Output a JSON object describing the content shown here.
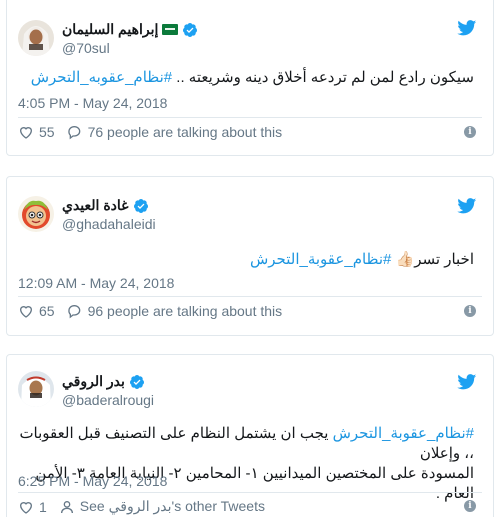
{
  "colors": {
    "link": "#1b95e0",
    "verified": "#1da1f2",
    "bird": "#1da1f2",
    "muted": "#657786"
  },
  "tweets": [
    {
      "name": "إبراهيم السليمان",
      "handle": "@70sul",
      "text_plain": "سيكون رادع لمن لم تردعه أخلاق دينه وشريعته .. ",
      "text_hashtag": "#نظام_عقوبه_التحرش",
      "time": "4:05 PM - May 24, 2018",
      "likes": "55",
      "talking": "76 people are talking about this"
    },
    {
      "name": "غادة العيدي",
      "handle": "@ghadahaleidi",
      "text_plain": "اخبار تسر👍🏻 ",
      "text_hashtag": "#نظام_عقوبة_التحرش",
      "time": "12:09 AM - May 24, 2018",
      "likes": "65",
      "talking": "96 people are talking about this"
    },
    {
      "name": "بدر الروقي",
      "handle": "@baderalrougi",
      "text_hashtag": "#نظام_عقوبة_التحرش",
      "text_line1_rest": " يجب ان يشتمل النظام على التصنيف قبل العقوبات ،، وإعلان",
      "text_line2": "المسودة على المختصين الميدانيين ١- المحامين ٢- النيابة العامة ٣- الأمن العام .",
      "time": "6:25 PM - May 24, 2018",
      "likes": "1",
      "see_prefix": "See ",
      "see_name": "بدر الروقي",
      "see_suffix": "'s other Tweets"
    }
  ],
  "icons": {
    "twitter": "twitter-bird-icon",
    "verified": "verified-badge-icon",
    "heart": "heart-icon",
    "comment": "comment-bubble-icon",
    "info": "info-icon",
    "profile": "person-icon"
  }
}
